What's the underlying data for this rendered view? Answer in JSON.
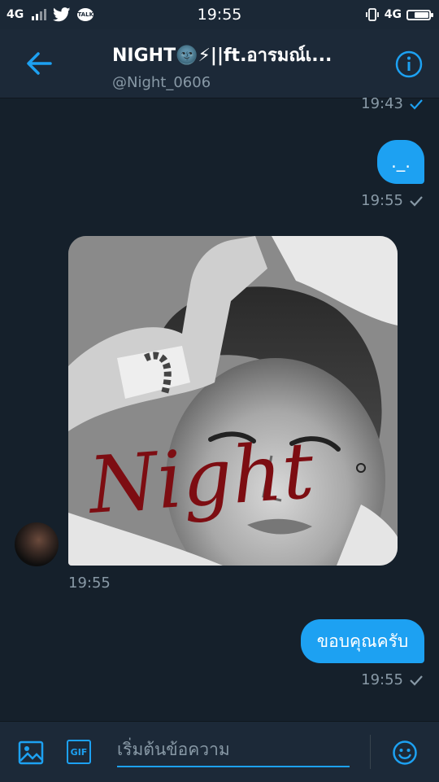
{
  "status_bar": {
    "network_left": "4G",
    "time": "19:55",
    "network_right": "4G",
    "talk_label": "TALK"
  },
  "header": {
    "title": "NIGHT🌚⚡||ft.อารมณ์เ...",
    "handle": "@Night_0606"
  },
  "messages": {
    "sent1_time": "19:43",
    "sent2_text": "._.",
    "sent2_time": "19:55",
    "received_time": "19:55",
    "photo_caption": "Night",
    "sent3_text": "ขอบคุณครับ",
    "sent3_time": "19:55"
  },
  "composer": {
    "gif_label": "GIF",
    "placeholder": "เริ่มต้นข้อความ"
  },
  "colors": {
    "background": "#15202b",
    "header": "#1c2938",
    "accent": "#1da1f2",
    "muted": "#8899a6",
    "signature": "#7d0d12"
  }
}
